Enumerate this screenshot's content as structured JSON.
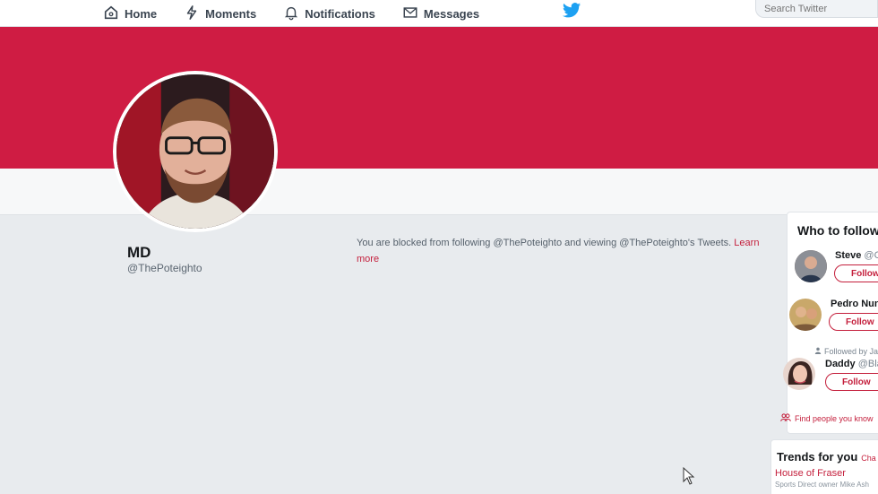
{
  "nav": {
    "home": "Home",
    "moments": "Moments",
    "notifications": "Notifications",
    "messages": "Messages"
  },
  "search": {
    "placeholder": "Search Twitter"
  },
  "icons": {
    "home": "home-icon",
    "moments": "moments-icon",
    "notifications": "bell-icon",
    "messages": "envelope-icon",
    "brand": "twitter-bird-icon"
  },
  "colors": {
    "brand_blue": "#1da1f2",
    "banner": "#cf1c43",
    "accent": "#c41f3c"
  },
  "profile": {
    "name": "MD",
    "handle": "@ThePoteighto"
  },
  "blocked": {
    "message": "You are blocked from following @ThePoteighto and viewing @ThePoteighto's Tweets. ",
    "link": "Learn more"
  },
  "who_to_follow": {
    "title": "Who to follow",
    "suggestions": [
      {
        "name": "Steve",
        "handle": "@C",
        "button": "Follow"
      },
      {
        "name": "Pedro Nun",
        "handle": "",
        "button": "Follow"
      },
      {
        "name": "Daddy",
        "handle": "@Bla",
        "button": "Follow",
        "followed_by": "Followed by Ja"
      }
    ],
    "find_people": "Find people you know"
  },
  "trends": {
    "title": "Trends for you",
    "change": "Cha",
    "items": [
      {
        "name": "House of Fraser",
        "description": "Sports Direct owner Mike Ash"
      }
    ]
  }
}
